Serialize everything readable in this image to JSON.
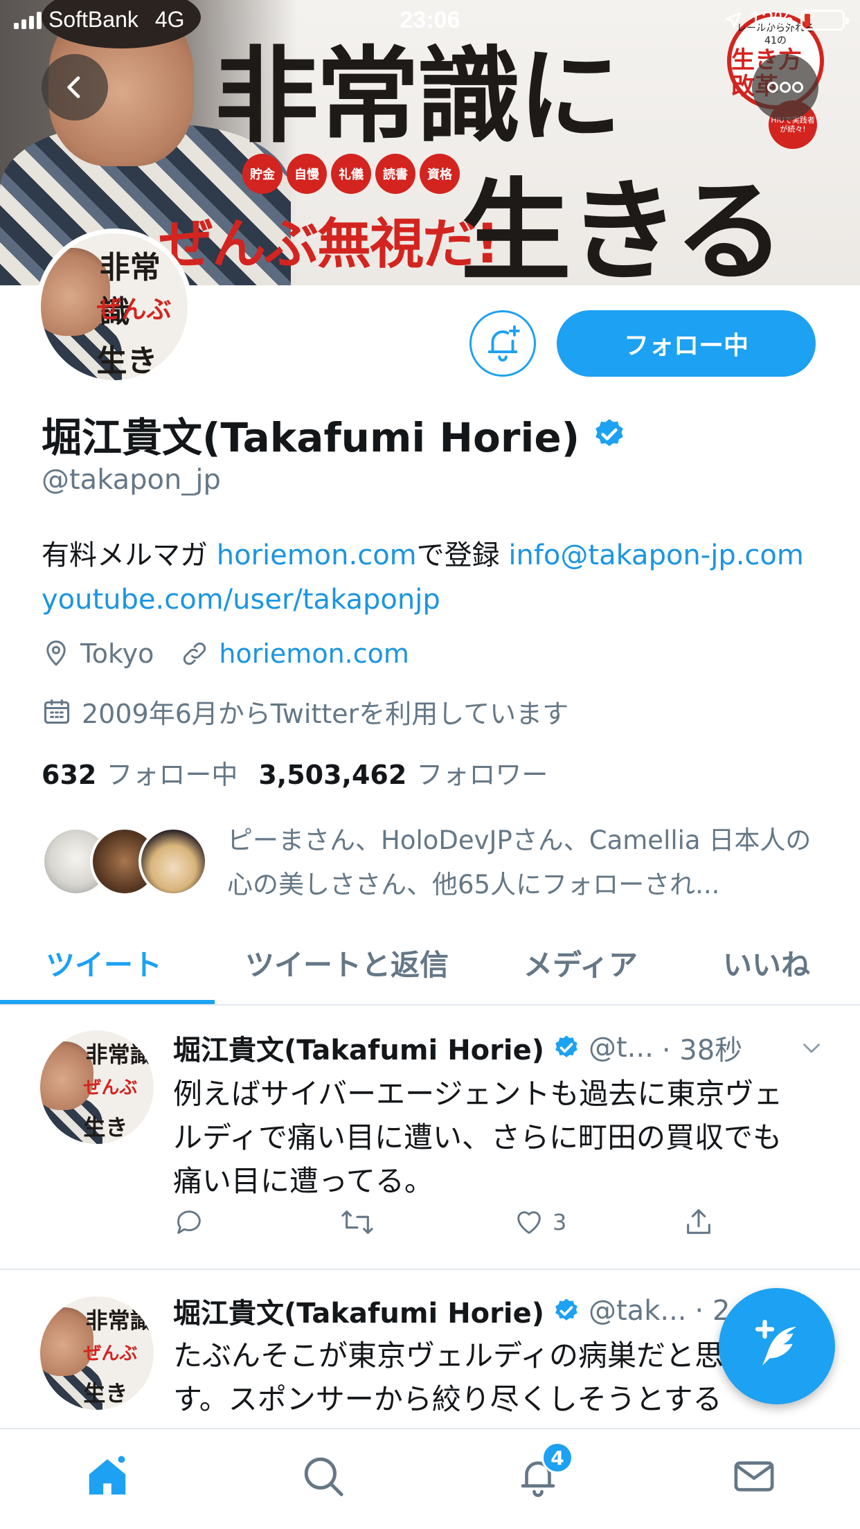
{
  "status_bar": {
    "carrier": "SoftBank",
    "network": "4G",
    "time": "23:06",
    "battery": "13%"
  },
  "banner": {
    "headline_1": "非常識に",
    "headline_2": "生きる",
    "subline": "ぜんぶ無視だ!",
    "chips": [
      "貯金",
      "自慢",
      "礼儀",
      "読書",
      "資格"
    ],
    "badge_small": "レールから外れる41の",
    "badge_big": "生き方改革",
    "badge2_text": "HIUで実践者が続々!"
  },
  "profile": {
    "follow_button": "フォロー中",
    "display_name": "堀江貴文(Takafumi Horie)",
    "handle": "@takapon_jp",
    "bio_prefix": "有料メルマガ ",
    "bio_link_1": "horiemon.com",
    "bio_middle": "で登録 ",
    "bio_link_2": "info@takapon-jp.com",
    "bio_link_3": "youtube.com/user/takaponjp",
    "location": "Tokyo",
    "website": "horiemon.com",
    "joined": "2009年6月からTwitterを利用しています",
    "following_count": "632",
    "following_label": "フォロー中",
    "followers_count": "3,503,462",
    "followers_label": "フォロワー",
    "followed_by": "ピーまさん、HoloDevJPさん、Camellia 日本人の心の美しささん、他65人にフォローされ..."
  },
  "tabs": [
    "ツイート",
    "ツイートと返信",
    "メディア",
    "いいね"
  ],
  "tweets": [
    {
      "name": "堀江貴文(Takafumi Horie)",
      "handle": "@t...",
      "time": "· 38秒",
      "text": "例えばサイバーエージェントも過去に東京ヴェルディで痛い目に遭い、さらに町田の買収でも痛い目に遭ってる。",
      "likes": "3"
    },
    {
      "name": "堀江貴文(Takafumi Horie)",
      "handle": "@tak...",
      "time": "· 2",
      "text": "たぶんそこが東京ヴェルディの病巣だと思います。スポンサーから絞り尽くしそうとする"
    }
  ],
  "nav": {
    "notifications_badge": "4"
  },
  "colors": {
    "accent": "#1da1f2",
    "link": "#1b95e0",
    "secondary_text": "#657786"
  }
}
